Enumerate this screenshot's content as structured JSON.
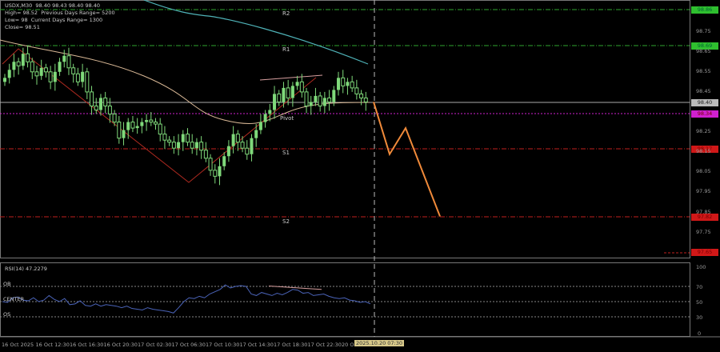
{
  "header": {
    "symbol_line": "USDX,M30  98.40 98.43 98.40 98.40",
    "high": "High= 98.52",
    "prev_range": "Previous Days Range= 5200",
    "low": "Low= 98",
    "cur_range": "Current Days Range= 1300",
    "close": "Close= 98.51"
  },
  "levels": {
    "r2": "R2",
    "r1": "R1",
    "pivot": "Pivot",
    "s1": "S1",
    "s2": "S2"
  },
  "price_labels": {
    "r2": "98.86",
    "r1": "98.69",
    "current": "98.40",
    "pivot": "98.34",
    "s1": "98.17",
    "s2": "97.82",
    "extra": "97.65"
  },
  "price_axis": [
    "98.75",
    "98.65",
    "98.55",
    "98.45",
    "98.25",
    "98.15",
    "98.05",
    "97.95",
    "97.85",
    "97.75"
  ],
  "rsi": {
    "title": "RSI(14) 47.2279",
    "ob": "OB",
    "center": "CENTER",
    "os": "OS",
    "axis": [
      "100",
      "70",
      "50",
      "30",
      "0"
    ]
  },
  "time_axis": [
    "16 Oct 2025",
    "16 Oct 12:30",
    "16 Oct 16:30",
    "16 Oct 20:30",
    "17 Oct 02:30",
    "17 Oct 06:30",
    "17 Oct 10:30",
    "17 Oct 14:30",
    "17 Oct 18:30",
    "17 Oct 22:30",
    "20 Oct"
  ],
  "time_cursor": "2025.10.20 07:30",
  "colors": {
    "bull": "#7fd97a",
    "r": "#2fa52f",
    "s": "#c0201e",
    "pivot": "#d020d0",
    "forecast": "#f08a3a",
    "ma_fast": "#d9b896",
    "ma_slow": "#4fb3b8",
    "rsi": "#4a63b8"
  },
  "chart_data": {
    "type": "candlestick",
    "price_range": [
      97.6,
      98.88
    ],
    "closes": [
      98.52,
      98.56,
      98.6,
      98.58,
      98.64,
      98.6,
      98.55,
      98.53,
      98.57,
      98.55,
      98.5,
      98.55,
      98.6,
      98.63,
      98.57,
      98.54,
      98.5,
      98.55,
      98.45,
      98.38,
      98.36,
      98.42,
      98.38,
      98.34,
      98.3,
      98.22,
      98.26,
      98.3,
      98.27,
      98.28,
      98.3,
      98.31,
      98.3,
      98.29,
      98.24,
      98.21,
      98.2,
      98.17,
      98.2,
      98.24,
      98.2,
      98.17,
      98.2,
      98.16,
      98.12,
      98.06,
      98.03,
      98.08,
      98.13,
      98.18,
      98.24,
      98.2,
      98.17,
      98.14,
      98.22,
      98.26,
      98.3,
      98.34,
      98.36,
      98.44,
      98.4,
      98.47,
      98.42,
      98.48,
      98.5,
      98.45,
      98.38,
      98.4,
      98.43,
      98.38,
      98.42,
      98.4,
      98.46,
      98.52,
      98.48,
      98.5,
      98.47,
      98.44,
      98.42,
      98.4
    ],
    "forecast": [
      98.4,
      98.14,
      98.27,
      97.83
    ],
    "rsi_values": [
      50,
      49,
      55,
      56,
      52,
      51,
      55,
      50,
      52,
      58,
      53,
      50,
      54,
      46,
      47,
      51,
      45,
      44,
      47,
      44,
      46,
      45,
      44,
      42,
      44,
      41,
      40,
      39,
      42,
      40,
      39,
      38,
      37,
      35,
      42,
      50,
      55,
      54,
      57,
      55,
      60,
      63,
      66,
      72,
      68,
      70,
      71,
      70,
      60,
      58,
      62,
      60,
      58,
      61,
      59,
      62,
      66,
      65,
      61,
      62,
      58,
      59,
      60,
      57,
      55,
      54,
      55,
      52,
      51,
      49,
      50,
      47
    ],
    "rsi_levels": {
      "ob": 70,
      "center": 50,
      "os": 30
    }
  }
}
